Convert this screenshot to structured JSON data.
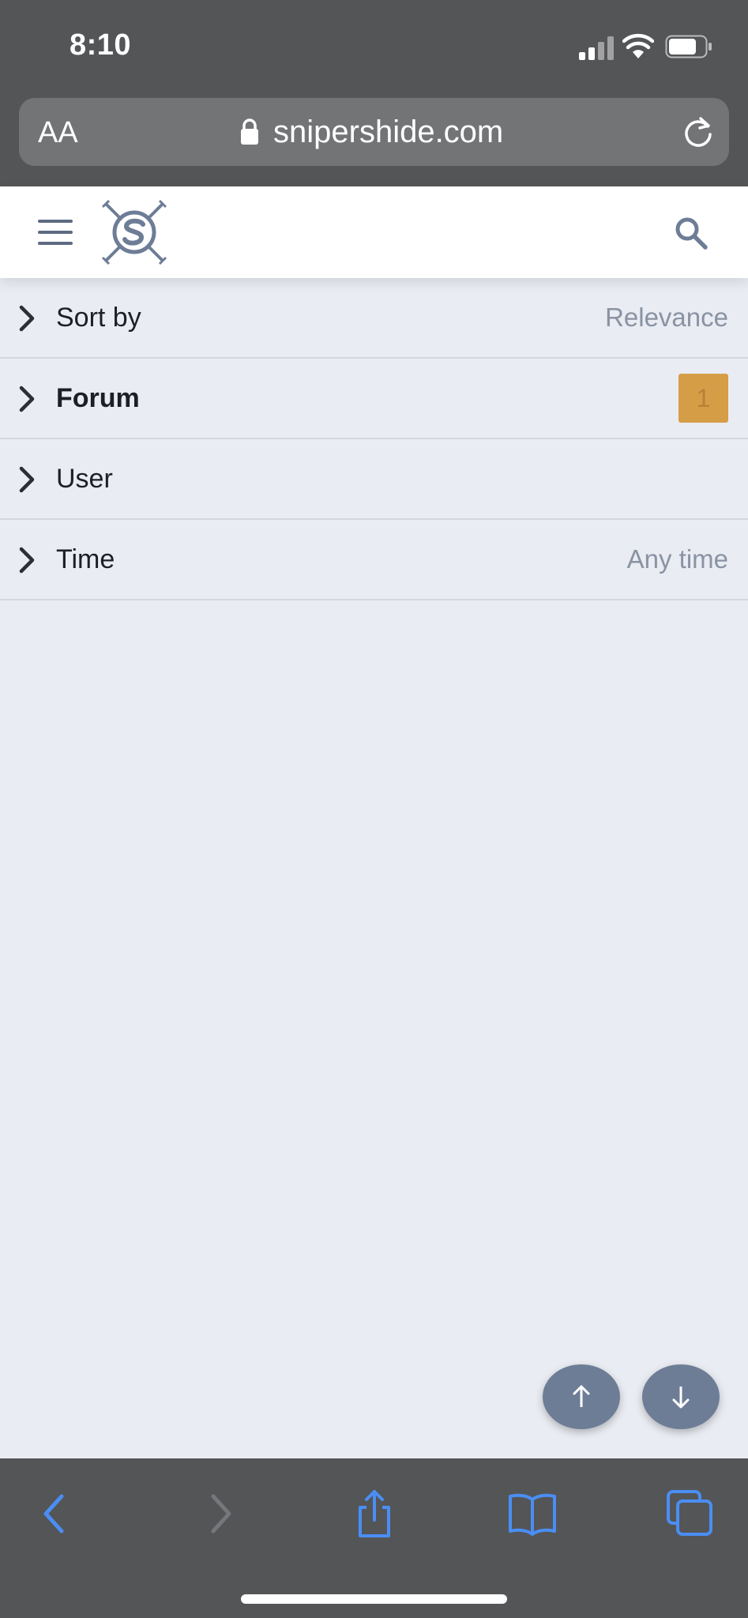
{
  "status_bar": {
    "time": "8:10"
  },
  "browser": {
    "text_size_label": "AA",
    "url": "snipershide.com"
  },
  "filters": [
    {
      "label": "Sort by",
      "value": "Relevance"
    },
    {
      "label": "Forum",
      "badge": "1"
    },
    {
      "label": "User",
      "value": ""
    },
    {
      "label": "Time",
      "value": "Any time"
    }
  ],
  "colors": {
    "chrome_bg": "#545557",
    "page_bg": "#e9ecf2",
    "badge_bg": "#d69d47",
    "fab_bg": "#6e7d96",
    "toolbar_active": "#4a8ef5"
  },
  "icons": {
    "menu": "hamburger-icon",
    "logo": "snipershide-logo",
    "search": "search-icon",
    "scroll_up": "arrow-up-icon",
    "scroll_down": "arrow-down-icon",
    "back": "chevron-left-icon",
    "forward": "chevron-right-icon",
    "share": "share-icon",
    "bookmarks": "book-icon",
    "tabs": "tabs-icon"
  }
}
